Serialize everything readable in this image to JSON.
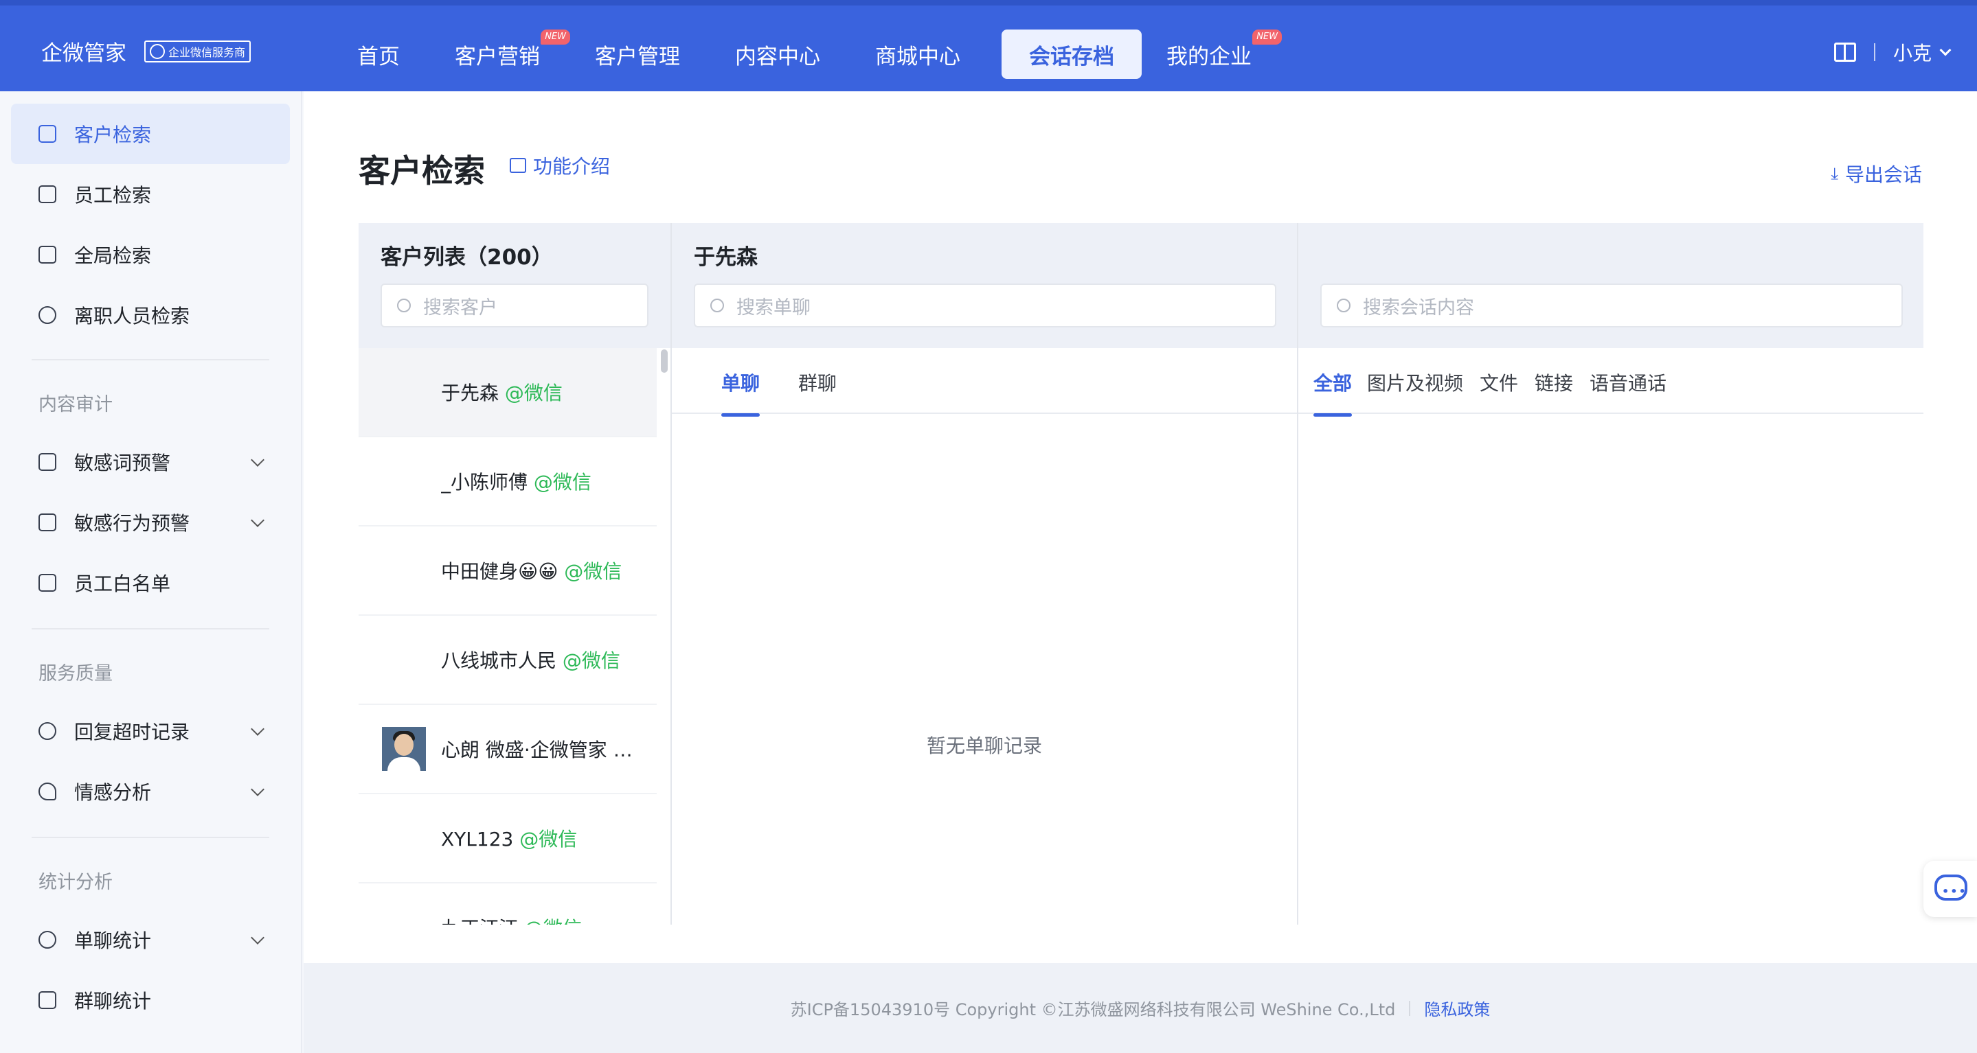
{
  "header": {
    "brand": "企微管家",
    "brand_badge": "企业微信服务商",
    "nav": [
      {
        "label": "首页",
        "new": false
      },
      {
        "label": "客户营销",
        "new": true
      },
      {
        "label": "客户管理",
        "new": false
      },
      {
        "label": "内容中心",
        "new": false
      },
      {
        "label": "商城中心",
        "new": false
      },
      {
        "label": "会话存档",
        "new": false,
        "active": true
      },
      {
        "label": "我的企业",
        "new": true
      }
    ],
    "new_tag": "NEW",
    "user": "小克"
  },
  "sidebar": {
    "items": [
      {
        "label": "客户检索"
      },
      {
        "label": "员工检索"
      },
      {
        "label": "全局检索"
      },
      {
        "label": "离职人员检索"
      }
    ],
    "section_audit": "内容审计",
    "audit_items": [
      {
        "label": "敏感词预警"
      },
      {
        "label": "敏感行为预警"
      },
      {
        "label": "员工白名单"
      }
    ],
    "section_quality": "服务质量",
    "quality_items": [
      {
        "label": "回复超时记录"
      },
      {
        "label": "情感分析"
      }
    ],
    "section_stats": "统计分析",
    "stats_items": [
      {
        "label": "单聊统计"
      },
      {
        "label": "群聊统计"
      }
    ]
  },
  "main": {
    "title": "客户检索",
    "func_intro": "功能介绍",
    "export": "导出会话",
    "customer_panel": {
      "title": "客户列表（200）",
      "search_placeholder": "搜索客户",
      "customers": [
        {
          "name": "于先森",
          "source": "@微信"
        },
        {
          "name": "_小陈师傅",
          "source": "@微信"
        },
        {
          "name": "中田健身😀😀",
          "source": "@微信"
        },
        {
          "name": "八线城市人民",
          "source": "@微信"
        },
        {
          "name": "心朗 微盛·企微管家",
          "source": "@..."
        },
        {
          "name": "XYL123",
          "source": "@微信"
        },
        {
          "name": "九正汪汪",
          "source": "@微信"
        }
      ]
    },
    "chat_panel": {
      "title": "于先森",
      "search_placeholder": "搜索单聊",
      "tabs": [
        "单聊",
        "群聊"
      ],
      "empty": "暂无单聊记录"
    },
    "content_panel": {
      "search_placeholder": "搜索会话内容",
      "tabs": [
        "全部",
        "图片及视频",
        "文件",
        "链接",
        "语音通话"
      ]
    }
  },
  "footer": {
    "copyright": "苏ICP备15043910号 Copyright ©江苏微盛网络科技有限公司 WeShine Co.,Ltd",
    "privacy": "隐私政策"
  }
}
